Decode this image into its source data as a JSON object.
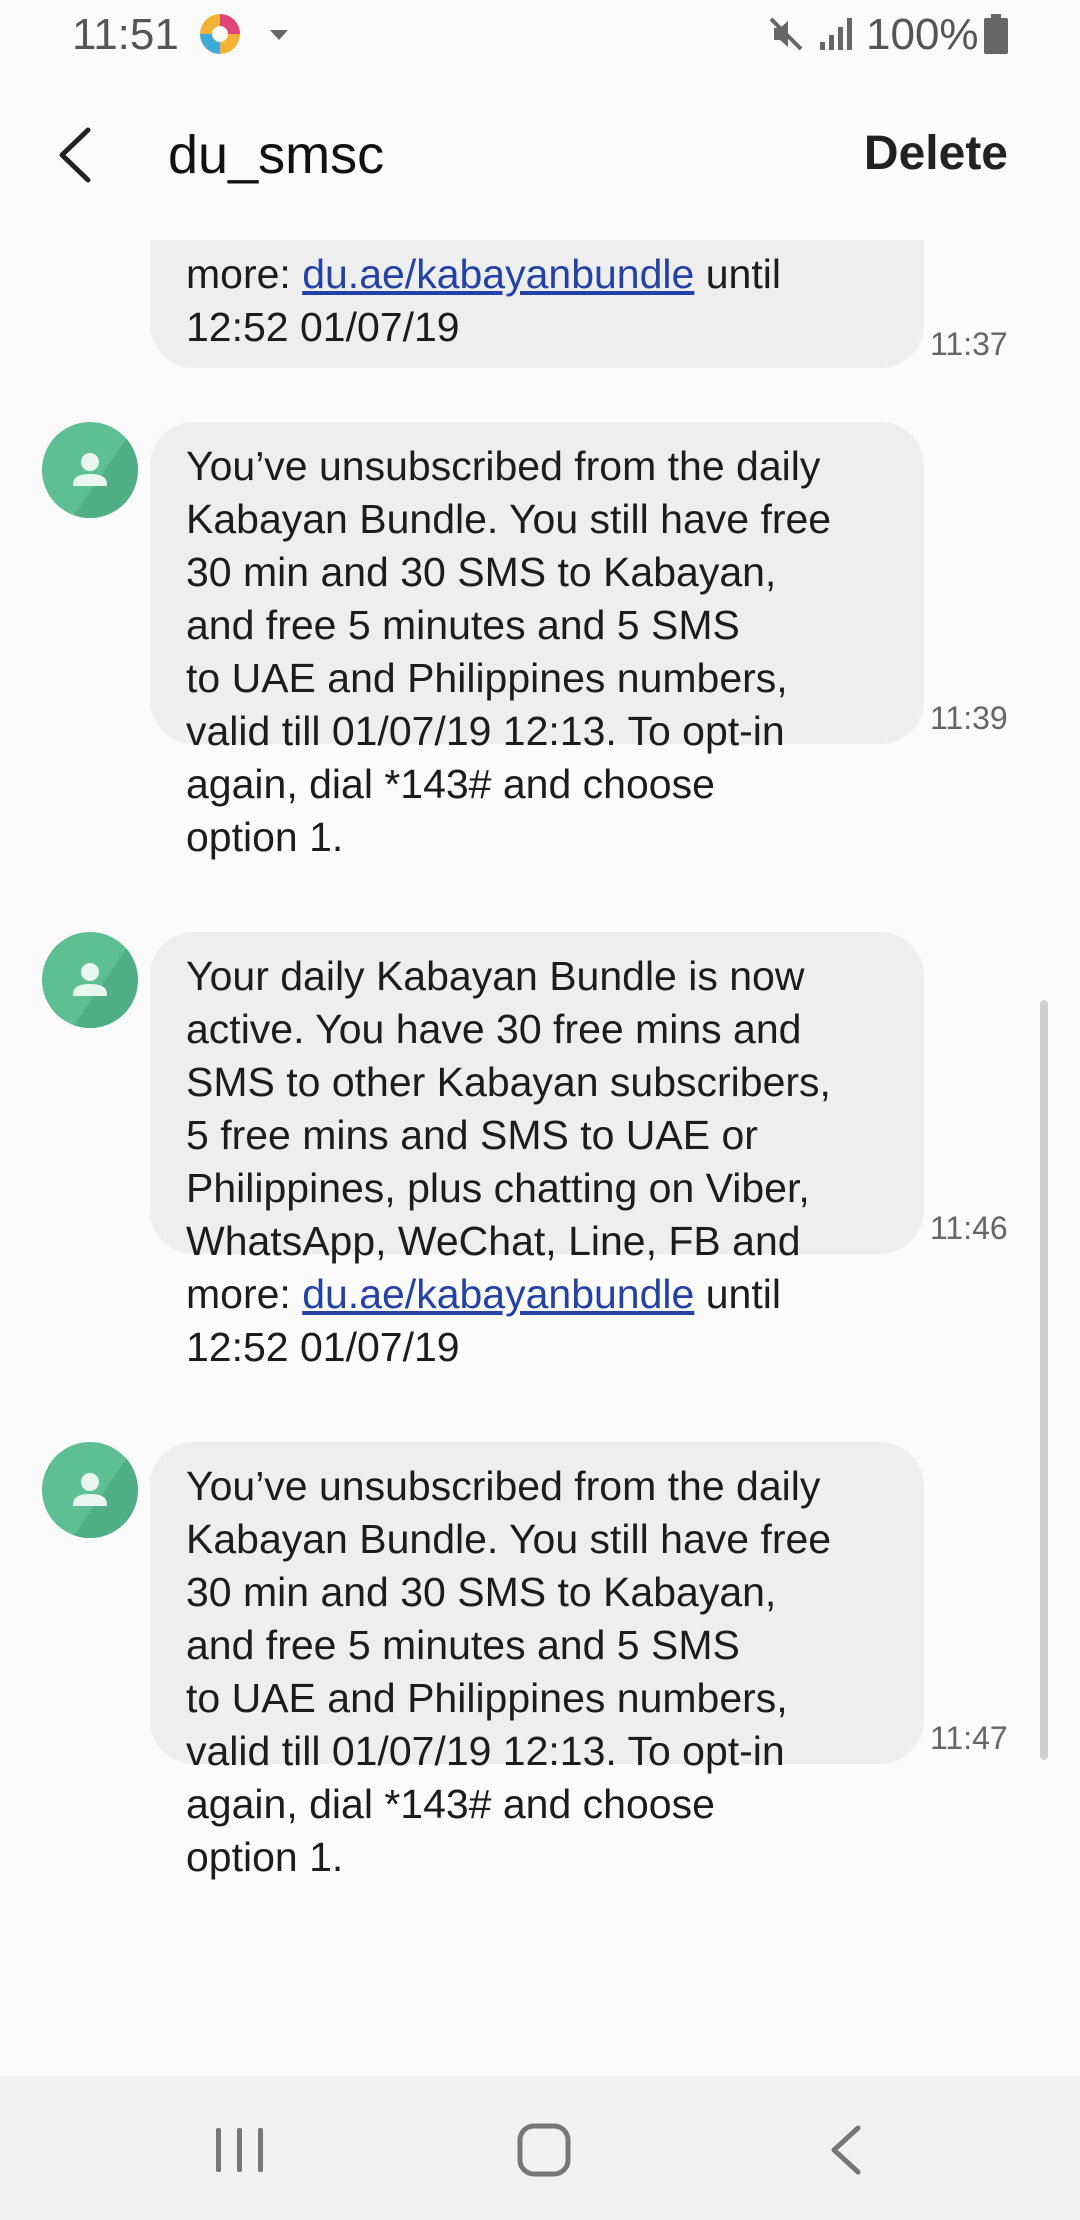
{
  "status_bar": {
    "time": "11:51",
    "battery": "100%",
    "icons": [
      "app-notification-icon",
      "dropdown-caret-icon",
      "mute-icon",
      "signal-icon",
      "battery-icon"
    ]
  },
  "header": {
    "title": "du_smsc",
    "delete_label": "Delete"
  },
  "messages": [
    {
      "text_before_link": "more: ",
      "link": "du.ae/kabayanbundle",
      "text_after_link": " until\n12:52 01/07/19",
      "time": "11:37"
    },
    {
      "text": "You’ve unsubscribed from the daily\nKabayan Bundle. You still have free\n30 min and 30 SMS to Kabayan,\nand free 5 minutes and 5 SMS\nto UAE and Philippines numbers,\nvalid till  01/07/19 12:13. To opt-in\nagain, dial *143# and choose\noption 1.",
      "time": "11:39"
    },
    {
      "text_before_link": "Your daily Kabayan Bundle is now\nactive. You have 30 free mins and\nSMS to other Kabayan subscribers,\n5 free mins and SMS to UAE or\nPhilippines, plus chatting on Viber,\nWhatsApp, WeChat, Line, FB and\nmore: ",
      "link": "du.ae/kabayanbundle",
      "text_after_link": " until\n12:52 01/07/19",
      "time": "11:46"
    },
    {
      "text": "You’ve unsubscribed from the daily\nKabayan Bundle. You still have free\n30 min and 30 SMS to Kabayan,\nand free 5 minutes and 5 SMS\nto UAE and Philippines numbers,\nvalid till  01/07/19 12:13. To opt-in\nagain, dial *143# and choose\noption 1.",
      "time": "11:47"
    }
  ],
  "colors": {
    "bubble": "#eeeeee",
    "avatar": "#5dbf92",
    "link": "#2441a6"
  }
}
